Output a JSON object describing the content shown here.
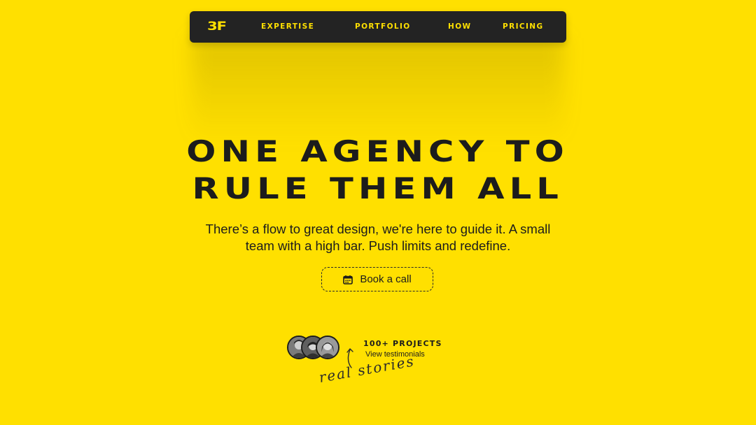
{
  "nav": {
    "logo": "3F",
    "links": [
      "EXPERTISE",
      "PORTFOLIO",
      "HOW",
      "PRICING"
    ]
  },
  "hero": {
    "title_line1": "ONE AGENCY TO",
    "title_line2": "RULE THEM ALL",
    "subtitle_line1": "There’s a flow to great design, we're here to guide it. A small",
    "subtitle_line2": "team with a high bar. Push limits and redefine.",
    "cta_label": "Book a call"
  },
  "social_proof": {
    "projects_label": "100+ PROJECTS",
    "testimonials_link": "View testimonials",
    "handwritten_note": "real stories"
  },
  "colors": {
    "background": "#FFE000",
    "nav_bg": "#232323",
    "text": "#1c1c1c"
  }
}
